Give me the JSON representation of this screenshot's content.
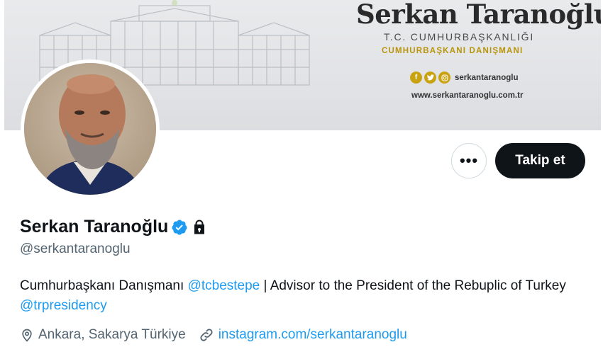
{
  "banner": {
    "name": "Serkan Taranoğlu",
    "organization": "T.C. CUMHURBAŞKANLIĞI",
    "role": "CUMHURBAŞKANI DANIŞMANI",
    "social_handle": "serkantaranoglu",
    "website": "www.serkantaranoglu.com.tr",
    "social_icons": [
      "facebook-icon",
      "twitter-icon",
      "instagram-icon"
    ],
    "accent_color": "#c9a210"
  },
  "actions": {
    "more_label": "•••",
    "follow_label": "Takip et"
  },
  "profile": {
    "display_name": "Serkan Taranoğlu",
    "handle": "@serkantaranoglu",
    "bio": {
      "text_1": "Cumhurbaşkanı Danışmanı ",
      "mention_1": "@tcbestepe",
      "text_2": " | Advisor to the President of the Rebuplic of Turkey ",
      "mention_2": "@trpresidency"
    },
    "location": "Ankara, Sakarya Türkiye",
    "website_link": "instagram.com/serkantaranoglu"
  },
  "colors": {
    "link": "#1d9bf0",
    "text": "#0f1419",
    "muted": "#536471",
    "verified": "#1d9bf0"
  }
}
